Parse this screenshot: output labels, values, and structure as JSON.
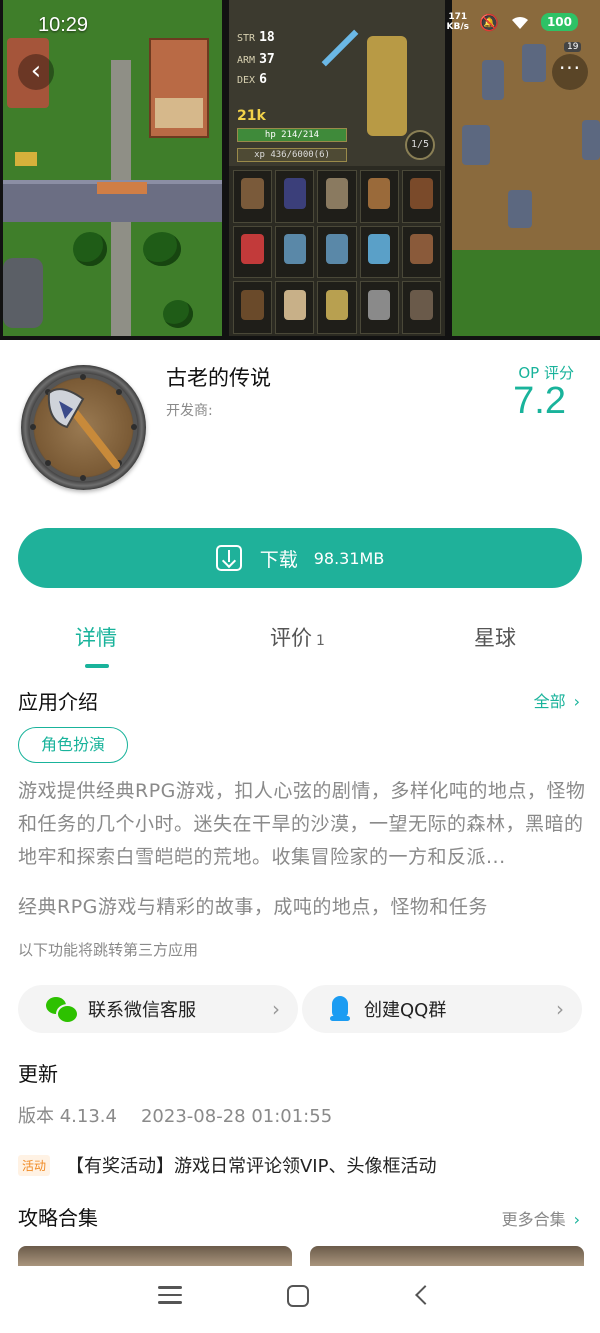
{
  "status_bar": {
    "time": "10:29",
    "net_speed_value": "171",
    "net_speed_unit": "KB/s",
    "battery": "100"
  },
  "game_screenshot": {
    "stats": [
      {
        "label": "STR",
        "value": "18"
      },
      {
        "label": "ARM",
        "value": "37"
      },
      {
        "label": "DEX",
        "value": "6"
      }
    ],
    "gold": "21k",
    "hp": "hp 214/214",
    "xp": "xp 436/6000(6)",
    "page": "1/5",
    "map_badge": "19"
  },
  "app": {
    "title": "古老的传说",
    "developer_label": "开发商:",
    "score_label": "OP 评分",
    "score": "7.2",
    "icon": "battle-axe-shield-icon"
  },
  "download": {
    "label": "下载",
    "size": "98.31MB"
  },
  "tabs": [
    {
      "label": "详情",
      "active": true
    },
    {
      "label": "评价",
      "count": "1"
    },
    {
      "label": "星球"
    }
  ],
  "intro": {
    "title": "应用介绍",
    "all_label": "全部",
    "tag": "角色扮演",
    "text": "游戏提供经典RPG游戏，扣人心弦的剧情，多样化吨的地点，怪物和任务的几个小时。迷失在干旱的沙漠，一望无际的森林，黑暗的地牢和探索白雪皑皑的荒地。收集冒险家的一方和反派...",
    "summary": "经典RPG游戏与精彩的故事，成吨的地点，怪物和任务",
    "third_party_note": "以下功能将跳转第三方应用"
  },
  "contacts": {
    "wechat": "联系微信客服",
    "qq": "创建QQ群"
  },
  "update": {
    "title": "更新",
    "version": "版本 4.13.4",
    "date": "2023-08-28 01:01:55",
    "activity_badge": "活动",
    "activity_text": "【有奖活动】游戏日常评论领VIP、头像框活动"
  },
  "guides": {
    "title": "攻略合集",
    "more_label": "更多合集"
  },
  "colors": {
    "accent": "#1fb19a",
    "activity": "#f08a24"
  }
}
